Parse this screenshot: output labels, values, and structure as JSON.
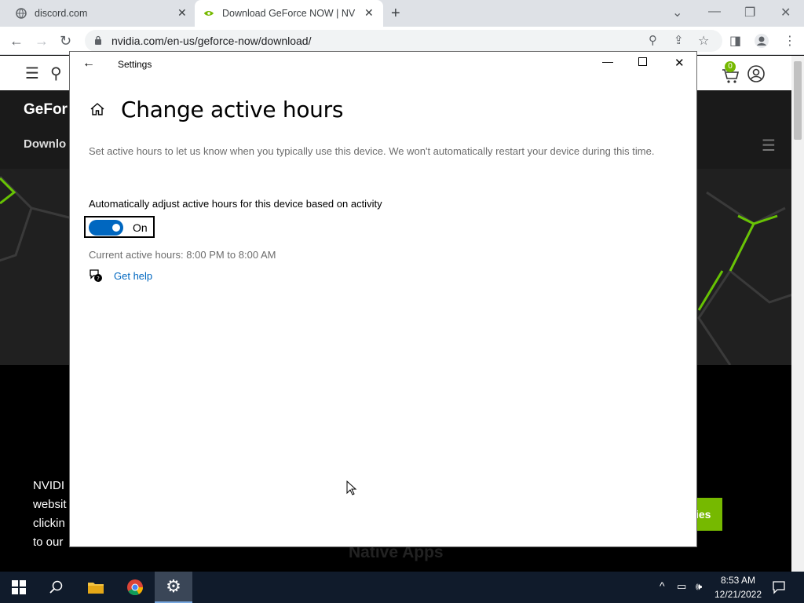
{
  "browser": {
    "tabs": [
      {
        "label": "discord.com"
      },
      {
        "label": "Download GeForce NOW | NVID"
      }
    ],
    "url": "nvidia.com/en-us/geforce-now/download/"
  },
  "page": {
    "header_brand": "GeFor",
    "subheader": "Downlo",
    "cart_count": "0",
    "body_lines": [
      "NVIDI",
      "websit",
      "clickin",
      "to our"
    ],
    "green_button": "ies",
    "footer_heading": "Native Apps"
  },
  "settings": {
    "window_title": "Settings",
    "page_title": "Change active hours",
    "description": "Set active hours to let us know when you typically use this device. We won't automatically restart your device during this time.",
    "toggle_label": "Automatically adjust active hours for this device based on activity",
    "toggle_state": "On",
    "current_hours": "Current active hours: 8:00 PM to 8:00 AM",
    "help_link": "Get help"
  },
  "taskbar": {
    "time": "8:53 AM",
    "date": "12/21/2022"
  },
  "colors": {
    "accent": "#0067c0",
    "nvidia_green": "#76b900",
    "taskbar": "#101b2b"
  }
}
